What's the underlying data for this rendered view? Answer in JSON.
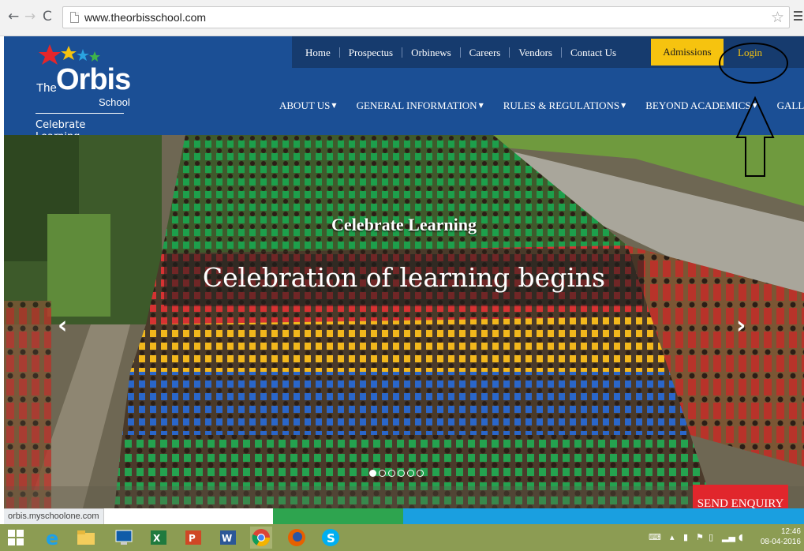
{
  "browser": {
    "url": "www.theorbisschool.com",
    "status_url": "orbis.myschoolone.com"
  },
  "logo": {
    "the": "The",
    "orbis": "Orbis",
    "school": "School",
    "tagline": "Celebrate  Learning"
  },
  "top_nav": {
    "items": [
      "Home",
      "Prospectus",
      "Orbinews",
      "Careers",
      "Vendors",
      "Contact Us"
    ],
    "admissions": "Admissions",
    "login": "Login"
  },
  "main_nav": {
    "items": [
      "ABOUT US",
      "GENERAL INFORMATION",
      "RULES & REGULATIONS",
      "BEYOND ACADEMICS",
      "GALLERY"
    ]
  },
  "hero": {
    "eyebrow": "Celebrate Learning",
    "title": "Celebration of learning begins",
    "slide_count": 6,
    "active_slide": 1
  },
  "enquiry": {
    "label": "SEND ENQUIRY"
  },
  "taskbar": {
    "time": "12:46",
    "date": "08-04-2016"
  },
  "colors": {
    "header_blue": "#1b4f95",
    "top_nav_blue": "#163b6e",
    "admissions_yellow": "#f6c30f",
    "enquiry_red": "#e1262c",
    "taskbar_green": "#8c9c53"
  }
}
